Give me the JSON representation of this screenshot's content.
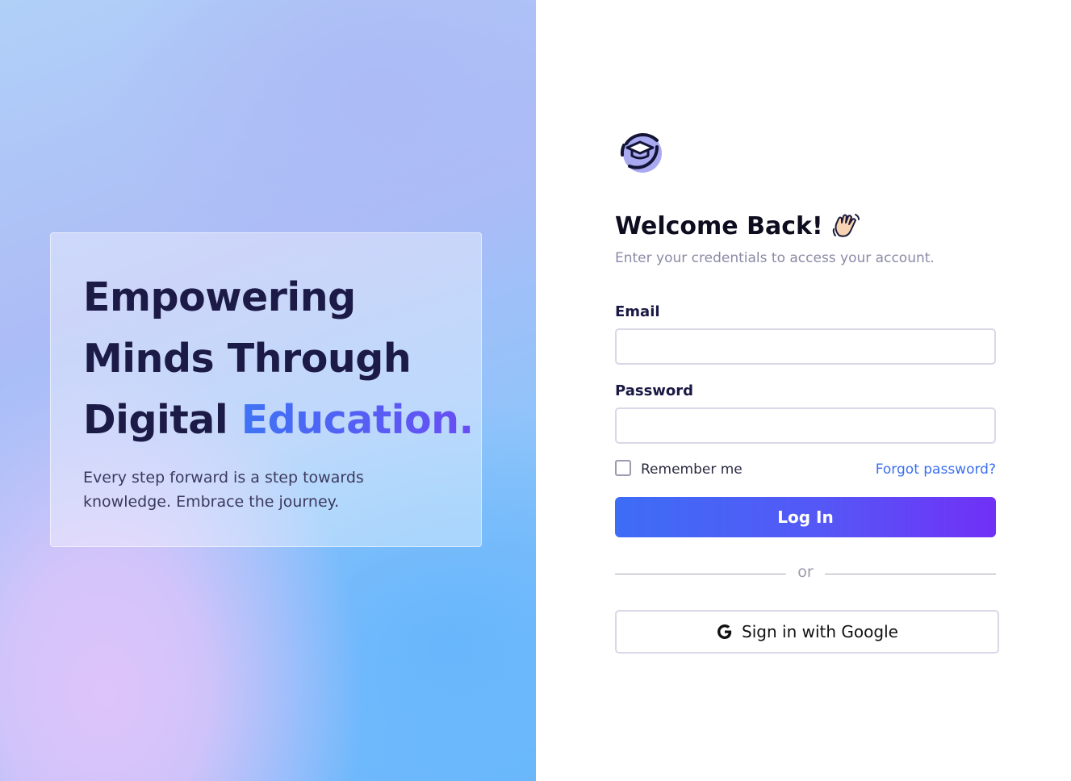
{
  "hero": {
    "title_line1": "Empowering",
    "title_line2": "Minds Through",
    "title_line3_plain": "Digital ",
    "title_line3_accent": "Education.",
    "subtitle_line1": "Every step forward is a step towards",
    "subtitle_line2": "knowledge. Embrace the journey."
  },
  "login": {
    "title": "Welcome Back!",
    "subtitle": "Enter your credentials to access your account.",
    "email_label": "Email",
    "email_value": "",
    "password_label": "Password",
    "password_value": "",
    "remember_label": "Remember me",
    "remember_checked": false,
    "forgot_label": "Forgot password?",
    "submit_label": "Log In",
    "divider_label": "or",
    "google_label": "Sign in with Google"
  },
  "icons": {
    "logo": "graduation-cap-icon",
    "wave": "waving-hand-icon",
    "google": "google-g-icon"
  },
  "colors": {
    "accent_start": "#3d6df6",
    "accent_end": "#7130f6",
    "link": "#3a6ff0",
    "heading": "#1c1a46"
  }
}
